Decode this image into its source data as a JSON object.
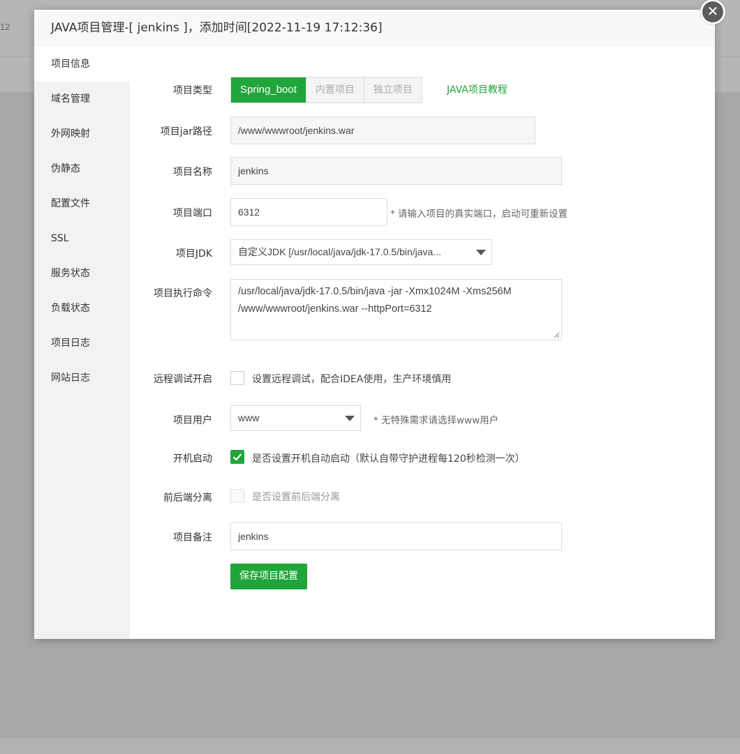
{
  "background": {
    "row_number": "12"
  },
  "dialog": {
    "title": "JAVA项目管理-[ jenkins ]，添加时间[2022-11-19 17:12:36]",
    "close_glyph": "✕"
  },
  "sidebar": {
    "items": [
      {
        "label": "项目信息"
      },
      {
        "label": "域名管理"
      },
      {
        "label": "外网映射"
      },
      {
        "label": "伪静态"
      },
      {
        "label": "配置文件"
      },
      {
        "label": "SSL"
      },
      {
        "label": "服务状态"
      },
      {
        "label": "负载状态"
      },
      {
        "label": "项目日志"
      },
      {
        "label": "网站日志"
      }
    ]
  },
  "form": {
    "project_type": {
      "label": "项目类型",
      "options": [
        "Spring_boot",
        "内置项目",
        "独立项目"
      ],
      "selected": "Spring_boot",
      "tutorial_link": "JAVA项目教程"
    },
    "jar_path": {
      "label": "项目jar路径",
      "value": "/www/wwwroot/jenkins.war"
    },
    "name": {
      "label": "项目名称",
      "value": "jenkins"
    },
    "port": {
      "label": "项目端口",
      "value": "6312",
      "hint": "* 请输入项目的真实端口，启动可重新设置"
    },
    "jdk": {
      "label": "项目JDK",
      "selected": "自定义JDK [/usr/local/java/jdk-17.0.5/bin/java..."
    },
    "command": {
      "label": "项目执行命令",
      "line1": "/usr/local/java/jdk-17.0.5/bin/java -jar -Xmx1024M -Xms256M",
      "line2": "/www/wwwroot/jenkins.war --httpPort=6312"
    },
    "remote_debug": {
      "label": "远程调试开启",
      "text": "设置远程调试，配合IDEA使用，生产环境慎用",
      "checked": false
    },
    "user": {
      "label": "项目用户",
      "selected": "www",
      "hint": "* 无特殊需求请选择www用户"
    },
    "autostart": {
      "label": "开机启动",
      "text": "是否设置开机自动启动（默认自带守护进程每120秒检测一次）",
      "checked": true
    },
    "separation": {
      "label": "前后端分离",
      "text": "是否设置前后端分离",
      "checked": false,
      "disabled": true
    },
    "remark": {
      "label": "项目备注",
      "value": "jenkins"
    },
    "save_label": "保存项目配置"
  },
  "colors": {
    "accent": "#20a53a",
    "overlay": "#a8a8a8"
  }
}
